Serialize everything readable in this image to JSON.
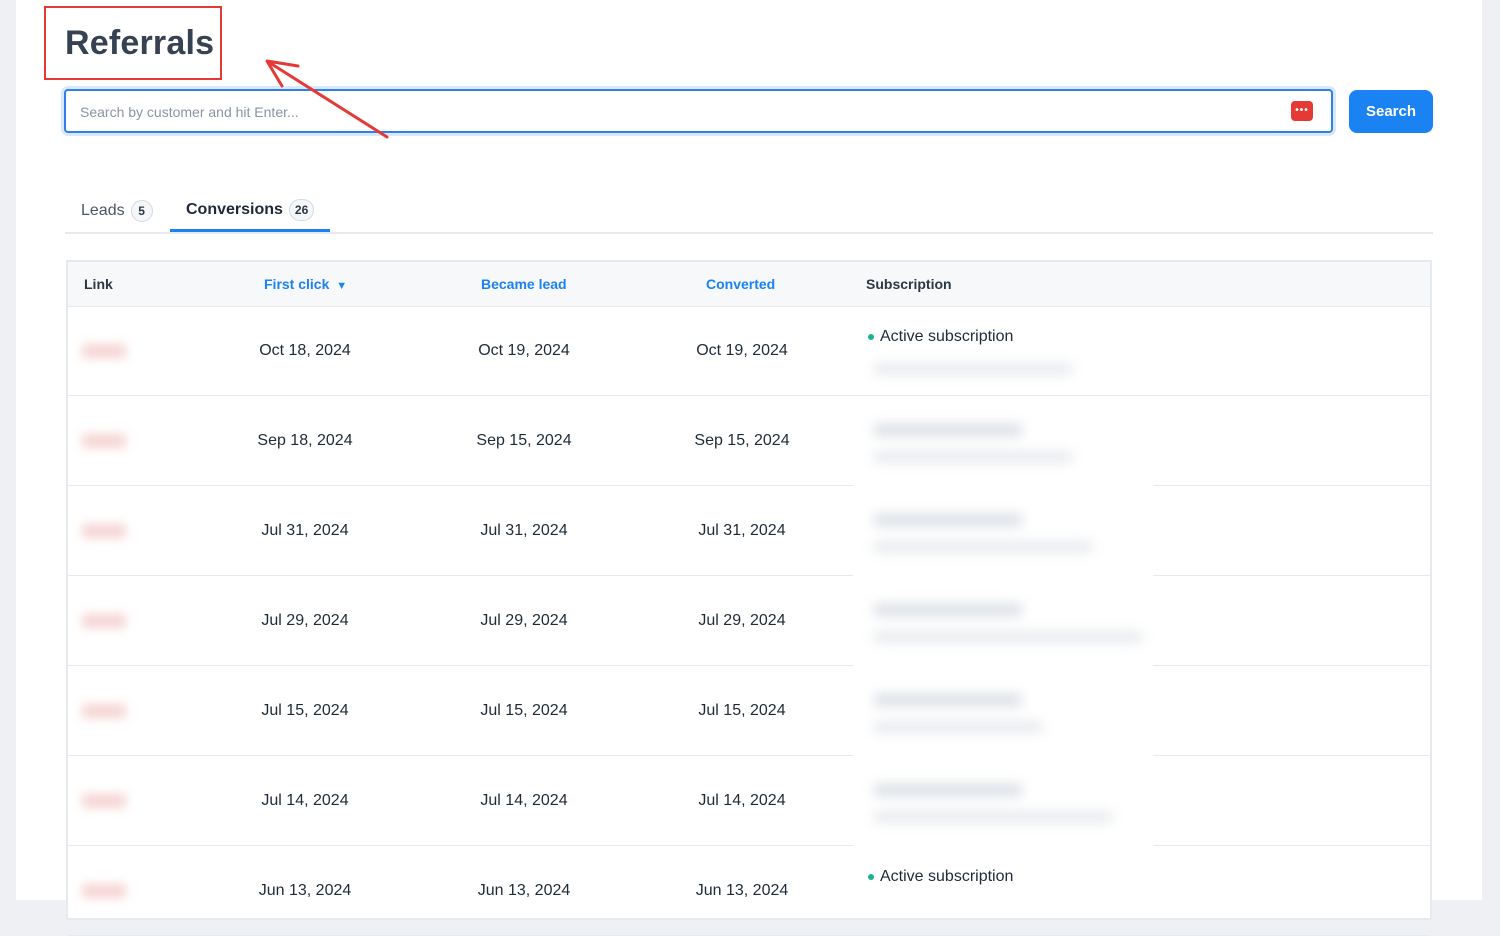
{
  "header": {
    "title": "Referrals"
  },
  "search": {
    "placeholder": "Search by customer and hit Enter...",
    "value": "",
    "button_label": "Search",
    "password_icon_text": "•••"
  },
  "tabs": [
    {
      "label": "Leads",
      "count": "5",
      "active": false
    },
    {
      "label": "Conversions",
      "count": "26",
      "active": true
    }
  ],
  "table": {
    "columns": {
      "link": "Link",
      "first_click": "First click",
      "first_click_sort": "▼",
      "became_lead": "Became lead",
      "converted": "Converted",
      "subscription": "Subscription"
    },
    "rows": [
      {
        "first_click": "Oct 18, 2024",
        "became_lead": "Oct 19, 2024",
        "converted": "Oct 19, 2024",
        "subscription": "Active subscription"
      },
      {
        "first_click": "Sep 18, 2024",
        "became_lead": "Sep 15, 2024",
        "converted": "Sep 15, 2024",
        "subscription": ""
      },
      {
        "first_click": "Jul 31, 2024",
        "became_lead": "Jul 31, 2024",
        "converted": "Jul 31, 2024",
        "subscription": ""
      },
      {
        "first_click": "Jul 29, 2024",
        "became_lead": "Jul 29, 2024",
        "converted": "Jul 29, 2024",
        "subscription": ""
      },
      {
        "first_click": "Jul 15, 2024",
        "became_lead": "Jul 15, 2024",
        "converted": "Jul 15, 2024",
        "subscription": ""
      },
      {
        "first_click": "Jul 14, 2024",
        "became_lead": "Jul 14, 2024",
        "converted": "Jul 14, 2024",
        "subscription": ""
      },
      {
        "first_click": "Jun 13, 2024",
        "became_lead": "Jun 13, 2024",
        "converted": "Jun 13, 2024",
        "subscription": "Active subscription"
      }
    ]
  },
  "colors": {
    "accent": "#1a82f2",
    "annotation_red": "#e53935",
    "status_active": "#19b394"
  }
}
